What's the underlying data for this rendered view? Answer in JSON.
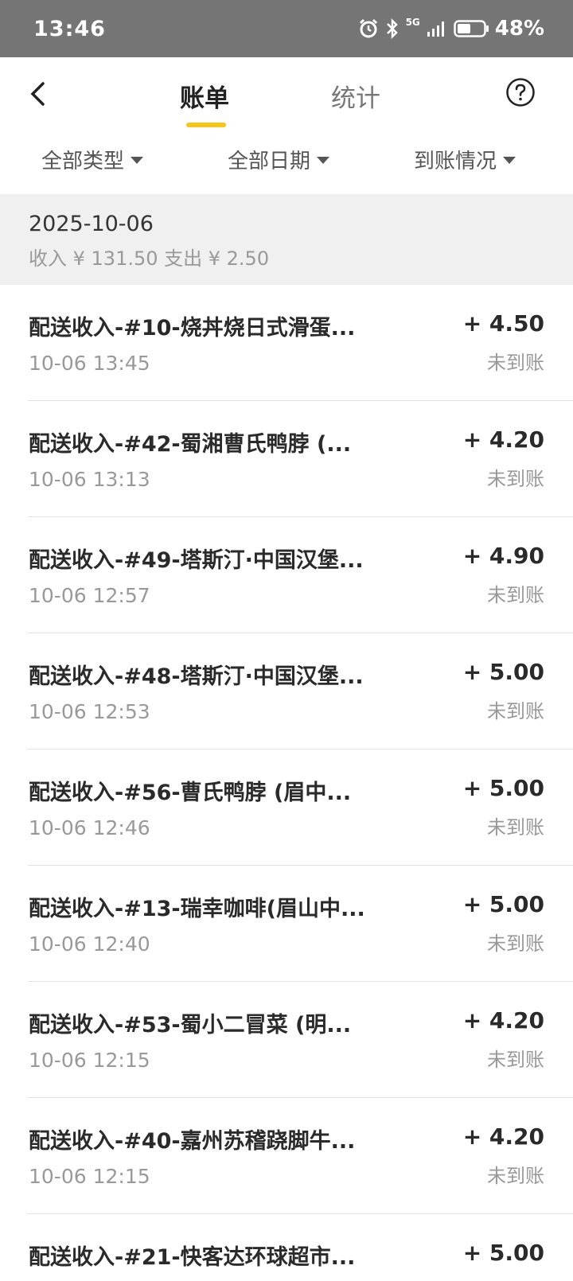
{
  "status_bar": {
    "time": "13:46",
    "network": "5G",
    "battery": "48%"
  },
  "header": {
    "tabs": [
      "账单",
      "统计"
    ],
    "active_tab": "账单",
    "help_icon": "question-icon",
    "back_icon": "chevron-left-icon"
  },
  "filters": [
    {
      "label": "全部类型"
    },
    {
      "label": "全部日期"
    },
    {
      "label": "到账情况"
    }
  ],
  "date_section": {
    "date": "2025-10-06",
    "summary": "收入 ¥ 131.50 支出 ¥ 2.50"
  },
  "rows": [
    {
      "title": "配送收入-#10-烧丼烧日式滑蛋...",
      "time": "10-06 13:45",
      "amount": "+ 4.50",
      "status": "未到账"
    },
    {
      "title": "配送收入-#42-蜀湘曹氏鸭脖 (...",
      "time": "10-06 13:13",
      "amount": "+ 4.20",
      "status": "未到账"
    },
    {
      "title": "配送收入-#49-塔斯汀·中国汉堡...",
      "time": "10-06 12:57",
      "amount": "+ 4.90",
      "status": "未到账"
    },
    {
      "title": "配送收入-#48-塔斯汀·中国汉堡...",
      "time": "10-06 12:53",
      "amount": "+ 5.00",
      "status": "未到账"
    },
    {
      "title": "配送收入-#56-曹氏鸭脖 (眉中...",
      "time": "10-06 12:46",
      "amount": "+ 5.00",
      "status": "未到账"
    },
    {
      "title": "配送收入-#13-瑞幸咖啡(眉山中...",
      "time": "10-06 12:40",
      "amount": "+ 5.00",
      "status": "未到账"
    },
    {
      "title": "配送收入-#53-蜀小二冒菜 (明...",
      "time": "10-06 12:15",
      "amount": "+ 4.20",
      "status": "未到账"
    },
    {
      "title": "配送收入-#40-嘉州苏稽跷脚牛...",
      "time": "10-06 12:15",
      "amount": "+ 4.20",
      "status": "未到账"
    },
    {
      "title": "配送收入-#21-快客达环球超市...",
      "time": "",
      "amount": "+ 5.00",
      "status": ""
    }
  ]
}
